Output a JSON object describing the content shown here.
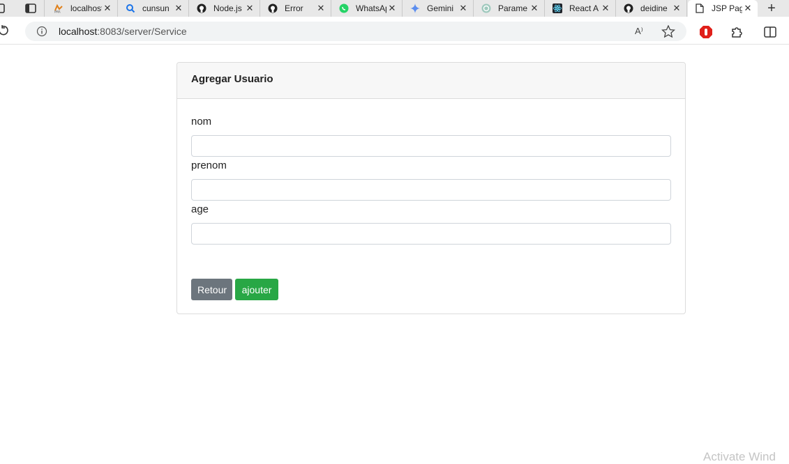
{
  "browser": {
    "tabs": [
      {
        "title": "localhost",
        "icon": "phpmyadmin-icon"
      },
      {
        "title": "cunsun",
        "icon": "search-icon"
      },
      {
        "title": "Node.js",
        "icon": "github-icon"
      },
      {
        "title": "Error",
        "icon": "github-icon"
      },
      {
        "title": "WhatsApp",
        "icon": "whatsapp-icon"
      },
      {
        "title": "Gemini",
        "icon": "gemini-icon"
      },
      {
        "title": "Parame",
        "icon": "chatgpt-icon"
      },
      {
        "title": "React A",
        "icon": "react-icon"
      },
      {
        "title": "deidine",
        "icon": "github-icon"
      },
      {
        "title": "JSP Page",
        "icon": "page-icon",
        "active": true
      }
    ],
    "url_host": "localhost",
    "url_rest": ":8083/server/Service",
    "read_aloud": "A⁾"
  },
  "card": {
    "title": "Agregar Usuario",
    "fields": [
      {
        "label": "nom",
        "value": ""
      },
      {
        "label": "prenom",
        "value": ""
      },
      {
        "label": "age",
        "value": ""
      }
    ],
    "back_label": "Retour",
    "add_label": "ajouter"
  },
  "watermark": "Activate Wind",
  "colors": {
    "back_button": "#6c757d",
    "add_button": "#28a745",
    "header_bg": "#f7f7f7"
  }
}
